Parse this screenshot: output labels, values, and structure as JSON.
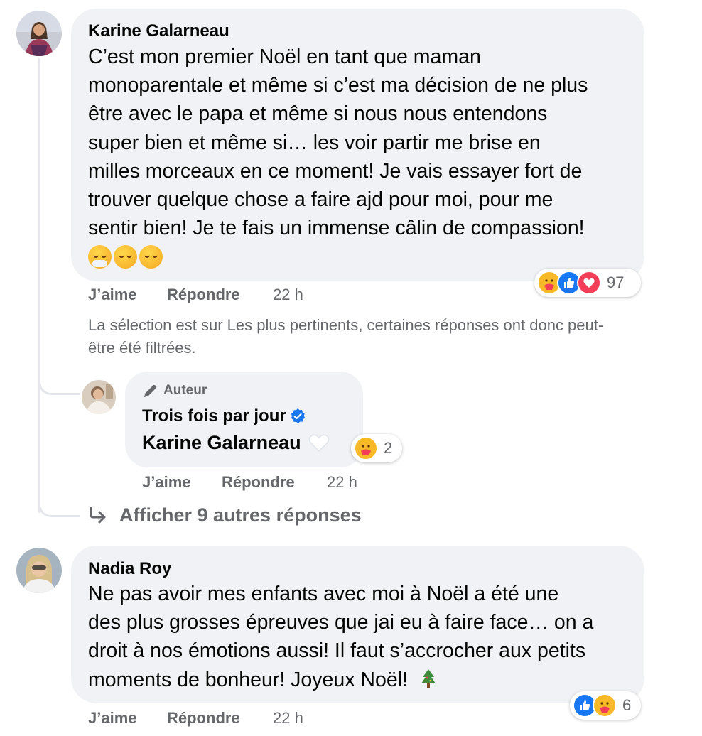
{
  "comments": [
    {
      "author": "Karine Galarneau",
      "text": "C’est mon premier Noël en tant que maman monoparentale et même si c’est ma décision de ne plus être avec le papa et même si nous nous entendons super bien et même si… les voir partir me brise en milles morceaux en ce moment! Je vais essayer fort de trouver quelque chose a faire ajd pour moi, pour me sentir bien! Je te fais un immense câlin de compassion!",
      "text_lines": [
        "C’est mon premier Noël en tant que maman",
        "monoparentale et même si c’est ma décision de ne plus",
        "être avec le papa et même si nous nous entendons",
        "super bien et même si… les voir partir me brise en",
        "milles morceaux en ce moment! Je vais essayer fort de",
        "trouver quelque chose a faire ajd pour moi, pour me",
        "sentir bien! Je te fais un immense câlin de compassion!"
      ],
      "emojis": [
        "hugging-face-emoji",
        "relieved-face-emoji",
        "relieved-face-emoji"
      ],
      "reaction_icons": [
        "care",
        "like",
        "love"
      ],
      "reaction_count": "97",
      "like_label": "J’aime",
      "reply_label": "Répondre",
      "time": "22 h"
    },
    {
      "author": "Nadia Roy",
      "text_lines": [
        "Ne pas avoir mes enfants avec moi à Noël a été une",
        "des plus grosses épreuves que jai eu à faire face… on a",
        "droit à nos émotions aussi! Il faut s’accrocher aux petits",
        "moments de bonheur! Joyeux Noël!"
      ],
      "emojis": [
        "christmas-tree-emoji"
      ],
      "reaction_icons": [
        "like",
        "care"
      ],
      "reaction_count": "6",
      "like_label": "J’aime",
      "reply_label": "Répondre",
      "time": "22 h"
    }
  ],
  "filter_note_lines": [
    "La sélection est sur Les plus pertinents, certaines réponses ont donc peut-",
    "être été filtrées."
  ],
  "reply": {
    "badge": "Auteur",
    "author": "Trois fois par jour",
    "verified": true,
    "text": "Karine Galarneau",
    "emoji": "white-heart-emoji",
    "reaction_icons": [
      "care"
    ],
    "reaction_count": "2",
    "like_label": "J’aime",
    "reply_label": "Répondre",
    "time": "22 h"
  },
  "more_replies_label": "Afficher 9 autres réponses",
  "colors": {
    "bubble": "#f0f2f5",
    "secondary_text": "#65676b",
    "like_blue": "#1877f2",
    "love_red": "#f33e58",
    "care_yellow": "#f7b928"
  }
}
